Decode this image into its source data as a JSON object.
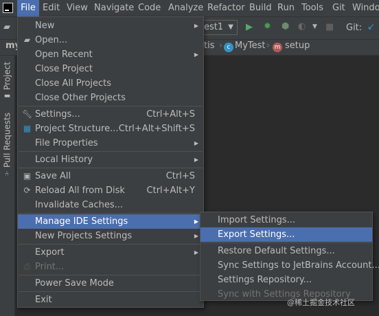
{
  "menubar": {
    "items": [
      {
        "label": "File"
      },
      {
        "label": "Edit"
      },
      {
        "label": "View"
      },
      {
        "label": "Navigate"
      },
      {
        "label": "Code"
      },
      {
        "label": "Analyze"
      },
      {
        "label": "Refactor"
      },
      {
        "label": "Build"
      },
      {
        "label": "Run"
      },
      {
        "label": "Tools"
      },
      {
        "label": "Git"
      },
      {
        "label": "Windo"
      }
    ]
  },
  "toolbar": {
    "run_config": "est1",
    "git_label": "Git:"
  },
  "navbar": {
    "project_name": "my",
    "crumbs": [
      {
        "label": "tis"
      },
      {
        "label": "MyTest",
        "icon": "class-icon"
      },
      {
        "label": "setup",
        "icon": "method-icon"
      }
    ]
  },
  "side_panel": {
    "tabs": [
      {
        "label": "Project"
      },
      {
        "label": "Pull Requests"
      }
    ]
  },
  "file_menu": {
    "items": [
      {
        "label": "New"
      },
      {
        "label": "Open..."
      },
      {
        "label": "Open Recent"
      },
      {
        "label": "Close Project"
      },
      {
        "label": "Close All Projects"
      },
      {
        "label": "Close Other Projects"
      },
      {
        "label": "Settings...",
        "shortcut": "Ctrl+Alt+S"
      },
      {
        "label": "Project Structure...",
        "shortcut": "Ctrl+Alt+Shift+S"
      },
      {
        "label": "File Properties"
      },
      {
        "label": "Local History"
      },
      {
        "label": "Save All",
        "shortcut": "Ctrl+S"
      },
      {
        "label": "Reload All from Disk",
        "shortcut": "Ctrl+Alt+Y"
      },
      {
        "label": "Invalidate Caches..."
      },
      {
        "label": "Manage IDE Settings"
      },
      {
        "label": "New Projects Settings"
      },
      {
        "label": "Export"
      },
      {
        "label": "Print..."
      },
      {
        "label": "Power Save Mode"
      },
      {
        "label": "Exit"
      }
    ]
  },
  "ide_settings_submenu": {
    "items": [
      {
        "label": "Import Settings..."
      },
      {
        "label": "Export Settings..."
      },
      {
        "label": "Restore Default Settings..."
      },
      {
        "label": "Sync Settings to JetBrains Account..."
      },
      {
        "label": "Settings Repository..."
      },
      {
        "label": "Sync with Settings Repository"
      }
    ]
  },
  "watermark": "@稀土掘金技术社区",
  "colors": {
    "background": "#2b2b2b",
    "panel": "#3c3f41",
    "highlight": "#4b6eaf",
    "run": "#59a869",
    "debug": "#499c54"
  }
}
